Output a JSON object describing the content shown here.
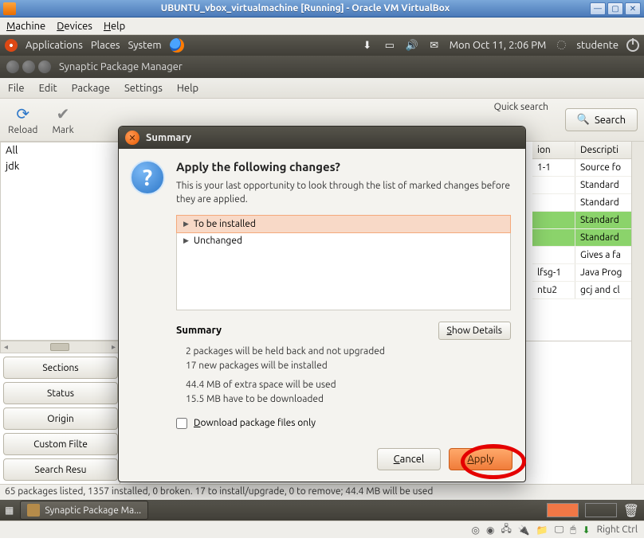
{
  "vbox": {
    "title": "UBUNTU_vbox_virtualmachine [Running] - Oracle VM VirtualBox",
    "menu": {
      "machine": "Machine",
      "devices": "Devices",
      "help": "Help"
    },
    "host_key": "Right Ctrl"
  },
  "gnome_top": {
    "applications": "Applications",
    "places": "Places",
    "system": "System",
    "clock": "Mon Oct 11,  2:06 PM",
    "user": "studente"
  },
  "synaptic": {
    "title": "Synaptic Package Manager",
    "menu": {
      "file": "File",
      "edit": "Edit",
      "package": "Package",
      "settings": "Settings",
      "help": "Help"
    },
    "toolbar": {
      "reload": "Reload",
      "mark": "Mark",
      "quick_search": "Quick search",
      "search": "Search"
    },
    "categories": {
      "all": "All",
      "jdk": "jdk"
    },
    "left_buttons": {
      "sections": "Sections",
      "status": "Status",
      "origin": "Origin",
      "custom": "Custom Filte",
      "search": "Search Resu"
    },
    "columns": {
      "version": "ion",
      "description": "Descripti"
    },
    "rows": [
      {
        "ver": "1-1",
        "desc": "Source fo",
        "green": false
      },
      {
        "ver": "",
        "desc": "Standard",
        "green": false
      },
      {
        "ver": "",
        "desc": "Standard",
        "green": false
      },
      {
        "ver": "",
        "desc": "Standard",
        "green": true
      },
      {
        "ver": "",
        "desc": "Standard",
        "green": true
      },
      {
        "ver": "",
        "desc": "Gives a fa",
        "green": false
      },
      {
        "ver": "lfsg-1",
        "desc": "Java Prog",
        "green": false
      },
      {
        "ver": "ntu2",
        "desc": "gcj and cl",
        "green": false
      }
    ],
    "status": "65 packages listed, 1357 installed, 0 broken. 17 to install/upgrade, 0 to remove; 44.4 MB will be used"
  },
  "dialog": {
    "title": "Summary",
    "heading": "Apply the following changes?",
    "body": "This is your last opportunity to look through the list of marked changes before they are applied.",
    "items": {
      "to_install": "To be installed",
      "unchanged": "Unchanged"
    },
    "summary_label": "Summary",
    "show_details": "Show Details",
    "lines": {
      "l1": "2 packages will be held back and not upgraded",
      "l2": "17 new packages will be installed",
      "l3": "44.4 MB of extra space will be used",
      "l4": "15.5 MB have to be downloaded"
    },
    "download_only": "Download package files only",
    "cancel": "Cancel",
    "apply": "Apply"
  },
  "gnome_bottom": {
    "task": "Synaptic Package Ma..."
  }
}
